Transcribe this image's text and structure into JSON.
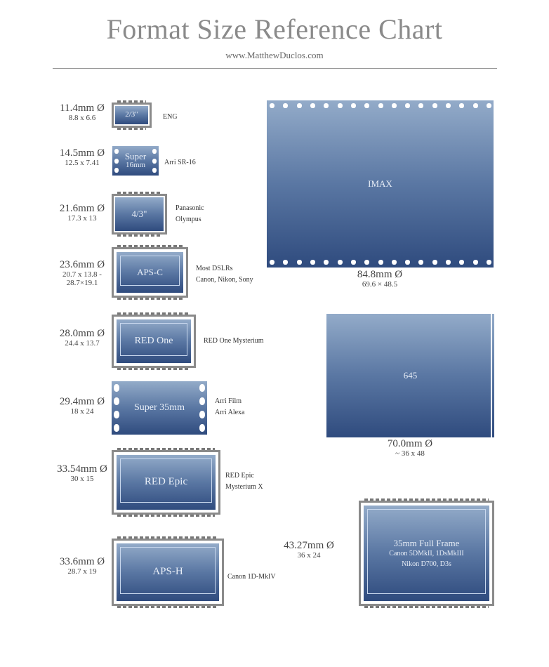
{
  "header": {
    "title": "Format Size Reference Chart",
    "subtitle": "www.MatthewDuclos.com"
  },
  "colors": {
    "sensor_top": "#93abc9",
    "sensor_bottom": "#2f4b7e",
    "frame": "#8a8a8a",
    "title": "#8a8a8a"
  },
  "formats": [
    {
      "id": "eng",
      "label": [
        "2/3\""
      ],
      "diagonal": "11.4mm Ø",
      "dimensions": [
        "8.8 x 6.6"
      ],
      "cameras": [
        "ENG"
      ],
      "style": "sensor"
    },
    {
      "id": "super16",
      "label": [
        "Super",
        "16mm"
      ],
      "diagonal": "14.5mm Ø",
      "dimensions": [
        "12.5 x 7.41"
      ],
      "cameras": [
        "Arri SR-16"
      ],
      "style": "film"
    },
    {
      "id": "four-thirds",
      "label": [
        "4/3\""
      ],
      "diagonal": "21.6mm Ø",
      "dimensions": [
        "17.3 x 13"
      ],
      "cameras": [
        "Panasonic",
        "Olympus"
      ],
      "style": "sensor"
    },
    {
      "id": "aps-c",
      "label": [
        "APS-C"
      ],
      "diagonal": "23.6mm Ø",
      "dimensions": [
        "20.7 x 13.8 -",
        "28.7×19.1"
      ],
      "cameras": [
        "Most DSLRs",
        "Canon, Nikon, Sony"
      ],
      "style": "sensor"
    },
    {
      "id": "red-one",
      "label": [
        "RED One"
      ],
      "diagonal": "28.0mm Ø",
      "dimensions": [
        "24.4 x 13.7"
      ],
      "cameras": [
        "RED One Mysterium"
      ],
      "style": "sensor"
    },
    {
      "id": "super35",
      "label": [
        "Super 35mm"
      ],
      "diagonal": "29.4mm Ø",
      "dimensions": [
        "18 x 24"
      ],
      "cameras": [
        "Arri Film",
        "Arri Alexa"
      ],
      "style": "film"
    },
    {
      "id": "red-epic",
      "label": [
        "RED Epic"
      ],
      "diagonal": "33.54mm Ø",
      "dimensions": [
        "30 x 15"
      ],
      "cameras": [
        "RED Epic",
        "Mysterium X"
      ],
      "style": "sensor"
    },
    {
      "id": "aps-h",
      "label": [
        "APS-H"
      ],
      "diagonal": "33.6mm Ø",
      "dimensions": [
        "28.7 x 19"
      ],
      "cameras": [
        "Canon 1D-MkIV"
      ],
      "style": "sensor"
    },
    {
      "id": "imax",
      "label": [
        "IMAX"
      ],
      "diagonal": "84.8mm Ø",
      "dimensions": [
        "69.6 × 48.5"
      ],
      "cameras": [],
      "style": "film-horizontal"
    },
    {
      "id": "645",
      "label": [
        "645"
      ],
      "diagonal": "70.0mm Ø",
      "dimensions": [
        "~ 36 x 48"
      ],
      "cameras": [],
      "style": "plain"
    },
    {
      "id": "full-frame",
      "label": [
        "35mm Full Frame",
        "Canon 5DMkII, 1DsMkIII",
        "Nikon D700, D3s"
      ],
      "diagonal": "43.27mm Ø",
      "dimensions": [
        "36 x 24"
      ],
      "cameras": [],
      "style": "sensor"
    }
  ]
}
